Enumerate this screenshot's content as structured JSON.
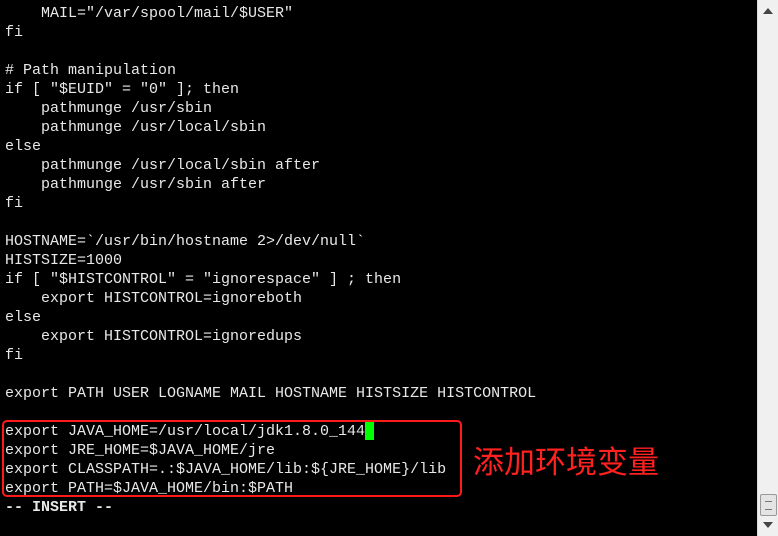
{
  "editor": {
    "lines": [
      "    MAIL=\"/var/spool/mail/$USER\"",
      "fi",
      "",
      "# Path manipulation",
      "if [ \"$EUID\" = \"0\" ]; then",
      "    pathmunge /usr/sbin",
      "    pathmunge /usr/local/sbin",
      "else",
      "    pathmunge /usr/local/sbin after",
      "    pathmunge /usr/sbin after",
      "fi",
      "",
      "HOSTNAME=`/usr/bin/hostname 2>/dev/null`",
      "HISTSIZE=1000",
      "if [ \"$HISTCONTROL\" = \"ignorespace\" ] ; then",
      "    export HISTCONTROL=ignoreboth",
      "else",
      "    export HISTCONTROL=ignoredups",
      "fi",
      "",
      "export PATH USER LOGNAME MAIL HOSTNAME HISTSIZE HISTCONTROL",
      "",
      "export JAVA_HOME=/usr/local/jdk1.8.0_144",
      "export JRE_HOME=$JAVA_HOME/jre",
      "export CLASSPATH=.:$JAVA_HOME/lib:${JRE_HOME}/lib",
      "export PATH=$JAVA_HOME/bin:$PATH"
    ],
    "mode": "-- INSERT --",
    "cursor_color": "#00ff00"
  },
  "annotation": {
    "text": "添加环境变量",
    "color": "#ff2020"
  }
}
